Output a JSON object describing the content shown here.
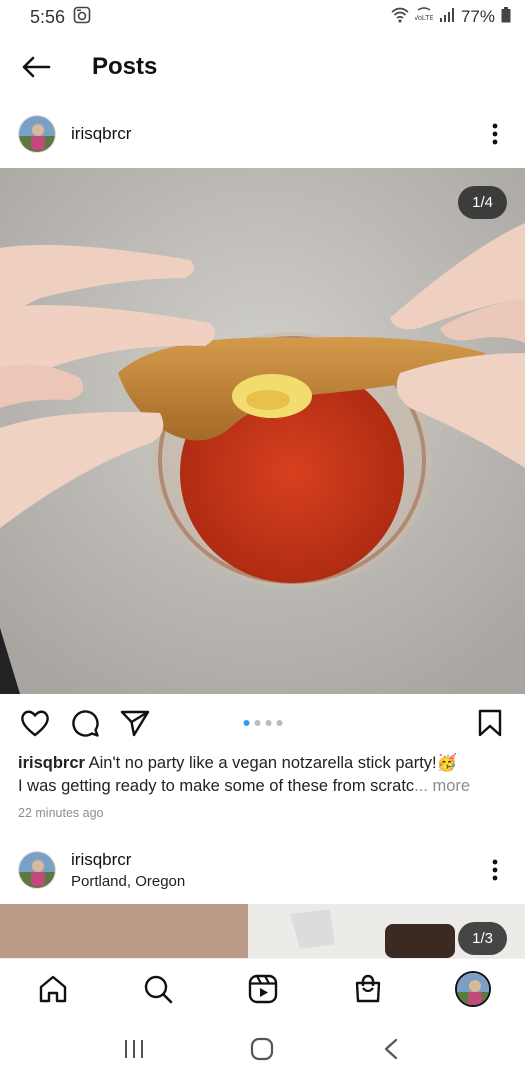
{
  "status_bar": {
    "time": "5:56",
    "battery": "77%",
    "icons": [
      "notification-icon",
      "wifi-icon",
      "volte-icon",
      "signal-icon",
      "battery-icon"
    ]
  },
  "header": {
    "title": "Posts"
  },
  "post1": {
    "username": "irisqbrcr",
    "counter": "1/4",
    "caption_user": "irisqbrcr",
    "caption_line1": "Ain't no party like a vegan notzarella stick party!🥳",
    "caption_line2": "I was getting ready to make some of these from scratc",
    "more_label": "... more",
    "timestamp": "22 minutes ago",
    "carousel_total": 4,
    "carousel_active": 1
  },
  "post2": {
    "username": "irisqbrcr",
    "location": "Portland, Oregon",
    "counter": "1/3"
  },
  "bottom_nav": {
    "items": [
      "home-icon",
      "search-icon",
      "reels-icon",
      "shop-icon",
      "profile-avatar"
    ]
  },
  "system_nav": {
    "items": [
      "recents-button",
      "home-button",
      "back-button"
    ]
  },
  "colors": {
    "accent_blue": "#3897f0",
    "text_dark": "#262626",
    "muted": "#8e8e8e"
  }
}
